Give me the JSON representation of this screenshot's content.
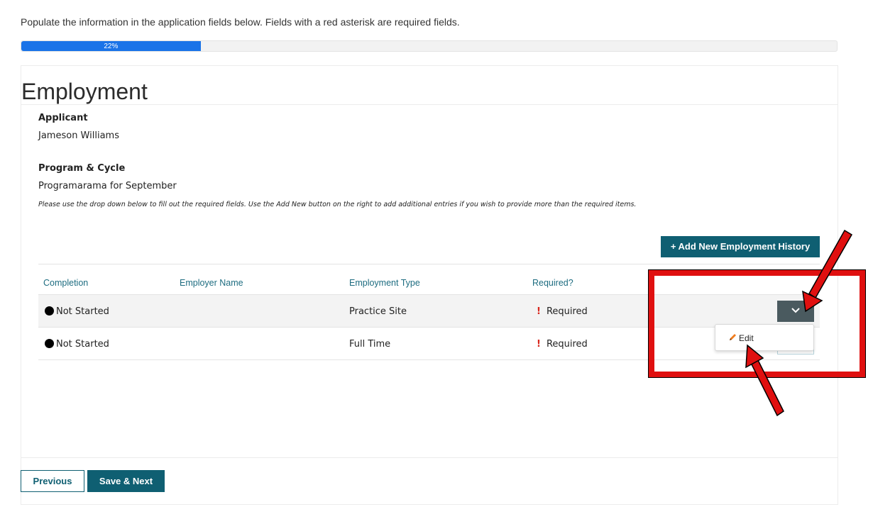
{
  "intro_text": "Populate the information in the application fields below. Fields with a red asterisk are required fields.",
  "progress": {
    "percent": 22,
    "label": "22%",
    "color": "#1a73e8"
  },
  "page_title": "Employment",
  "applicant": {
    "label": "Applicant",
    "value": "Jameson Williams"
  },
  "program": {
    "label": "Program & Cycle",
    "value": "Programarama for September"
  },
  "note": "Please use the drop down below to fill out the required fields. Use the Add New button on the right to add additional entries if you wish to provide more than the required items.",
  "add_button_label": "+ Add New Employment History",
  "table": {
    "headers": {
      "completion": "Completion",
      "employer_name": "Employer Name",
      "employment_type": "Employment Type",
      "required": "Required?"
    },
    "rows": [
      {
        "completion": "Not Started",
        "employer_name": "",
        "employment_type": "Practice Site",
        "required": "Required"
      },
      {
        "completion": "Not Started",
        "employer_name": "",
        "employment_type": "Full Time",
        "required": "Required"
      }
    ]
  },
  "dropdown_menu": {
    "items": [
      {
        "label": "Edit",
        "icon": "pencil-icon"
      }
    ]
  },
  "footer": {
    "previous_label": "Previous",
    "save_next_label": "Save & Next"
  },
  "colors": {
    "primary": "#0f5f72",
    "required": "#d9261c",
    "annotation": "#e01010"
  }
}
